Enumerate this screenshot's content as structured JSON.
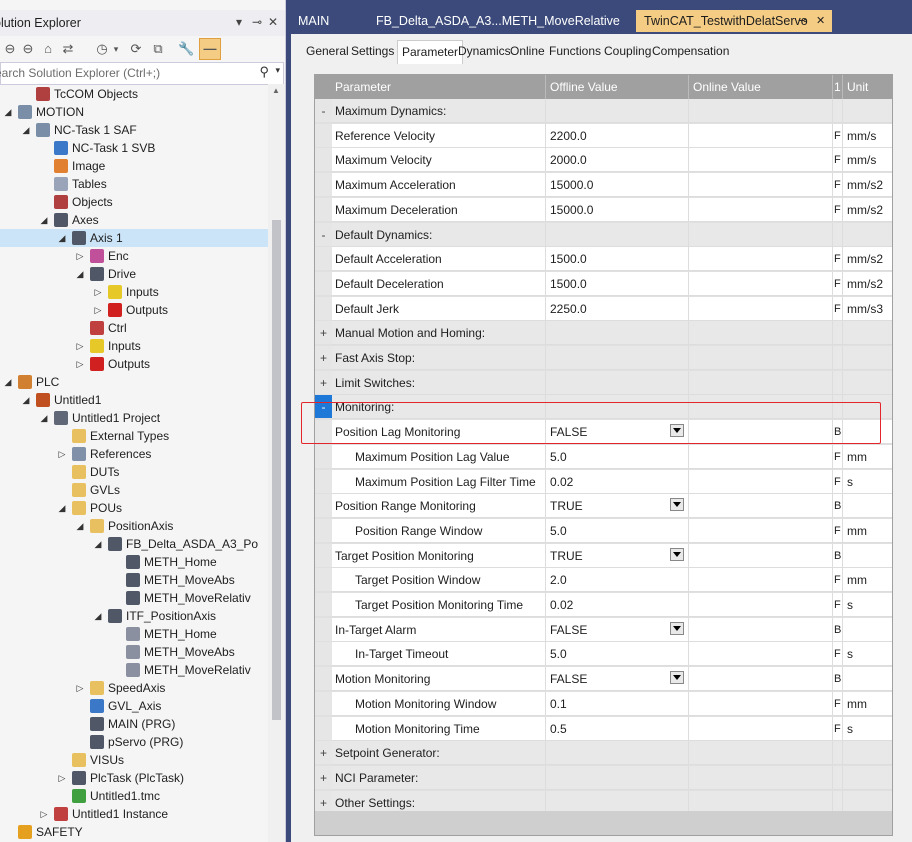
{
  "solution_explorer": {
    "title": "olution Explorer",
    "search_placeholder": "earch Solution Explorer (Ctrl+;)",
    "tree": [
      {
        "label": "TcCOM Objects",
        "indent": 2,
        "expand": "",
        "icon": "tccom-icon",
        "color": "#b04040"
      },
      {
        "label": "MOTION",
        "indent": 1,
        "expand": "◢",
        "icon": "motion-icon",
        "color": "#7a8ea8"
      },
      {
        "label": "NC-Task 1 SAF",
        "indent": 2,
        "expand": "◢",
        "icon": "nc-task-icon",
        "color": "#7a8ea8"
      },
      {
        "label": "NC-Task 1 SVB",
        "indent": 3,
        "expand": "",
        "icon": "nc-svb-icon",
        "color": "#3c78c8"
      },
      {
        "label": "Image",
        "indent": 3,
        "expand": "",
        "icon": "image-icon",
        "color": "#e08030"
      },
      {
        "label": "Tables",
        "indent": 3,
        "expand": "",
        "icon": "tables-icon",
        "color": "#9aa4b8"
      },
      {
        "label": "Objects",
        "indent": 3,
        "expand": "",
        "icon": "objects-icon",
        "color": "#b04040"
      },
      {
        "label": "Axes",
        "indent": 3,
        "expand": "◢",
        "icon": "axes-icon",
        "color": "#505868"
      },
      {
        "label": "Axis 1",
        "indent": 4,
        "expand": "◢",
        "icon": "axis-icon",
        "color": "#505868",
        "selected": true
      },
      {
        "label": "Enc",
        "indent": 5,
        "expand": "▷",
        "icon": "encoder-icon",
        "color": "#c0509a"
      },
      {
        "label": "Drive",
        "indent": 5,
        "expand": "◢",
        "icon": "drive-icon",
        "color": "#505868"
      },
      {
        "label": "Inputs",
        "indent": 6,
        "expand": "▷",
        "icon": "inputs-icon",
        "color": "#e6c828"
      },
      {
        "label": "Outputs",
        "indent": 6,
        "expand": "▷",
        "icon": "outputs-icon",
        "color": "#d02020"
      },
      {
        "label": "Ctrl",
        "indent": 5,
        "expand": "",
        "icon": "ctrl-icon",
        "color": "#c04040"
      },
      {
        "label": "Inputs",
        "indent": 5,
        "expand": "▷",
        "icon": "inputs-icon",
        "color": "#e6c828"
      },
      {
        "label": "Outputs",
        "indent": 5,
        "expand": "▷",
        "icon": "outputs-icon",
        "color": "#d02020"
      },
      {
        "label": "PLC",
        "indent": 1,
        "expand": "◢",
        "icon": "plc-icon",
        "color": "#d08030"
      },
      {
        "label": "Untitled1",
        "indent": 2,
        "expand": "◢",
        "icon": "plc-project-icon",
        "color": "#c05020"
      },
      {
        "label": "Untitled1 Project",
        "indent": 3,
        "expand": "◢",
        "icon": "project-icon",
        "color": "#606878"
      },
      {
        "label": "External Types",
        "indent": 4,
        "expand": "",
        "icon": "folder-icon",
        "color": "#e8c060"
      },
      {
        "label": "References",
        "indent": 4,
        "expand": "▷",
        "icon": "references-icon",
        "color": "#8090a8"
      },
      {
        "label": "DUTs",
        "indent": 4,
        "expand": "",
        "icon": "folder-icon",
        "color": "#e8c060"
      },
      {
        "label": "GVLs",
        "indent": 4,
        "expand": "",
        "icon": "folder-icon",
        "color": "#e8c060"
      },
      {
        "label": "POUs",
        "indent": 4,
        "expand": "◢",
        "icon": "folder-open-icon",
        "color": "#e8c060"
      },
      {
        "label": "PositionAxis",
        "indent": 5,
        "expand": "◢",
        "icon": "folder-open-icon",
        "color": "#e8c060"
      },
      {
        "label": "FB_Delta_ASDA_A3_Po",
        "indent": 6,
        "expand": "◢",
        "icon": "function-block-icon",
        "color": "#505868"
      },
      {
        "label": "METH_Home",
        "indent": 7,
        "expand": "",
        "icon": "method-icon",
        "color": "#505868"
      },
      {
        "label": "METH_MoveAbs",
        "indent": 7,
        "expand": "",
        "icon": "method-icon",
        "color": "#505868"
      },
      {
        "label": "METH_MoveRelativ",
        "indent": 7,
        "expand": "",
        "icon": "method-icon",
        "color": "#505868"
      },
      {
        "label": "ITF_PositionAxis",
        "indent": 6,
        "expand": "◢",
        "icon": "interface-icon",
        "color": "#505868"
      },
      {
        "label": "METH_Home",
        "indent": 7,
        "expand": "",
        "icon": "method-icon",
        "color": "#8a90a0"
      },
      {
        "label": "METH_MoveAbs",
        "indent": 7,
        "expand": "",
        "icon": "method-icon",
        "color": "#8a90a0"
      },
      {
        "label": "METH_MoveRelativ",
        "indent": 7,
        "expand": "",
        "icon": "method-icon",
        "color": "#8a90a0"
      },
      {
        "label": "SpeedAxis",
        "indent": 5,
        "expand": "▷",
        "icon": "folder-icon",
        "color": "#e8c060"
      },
      {
        "label": "GVL_Axis",
        "indent": 5,
        "expand": "",
        "icon": "gvl-icon",
        "color": "#3c78c8"
      },
      {
        "label": "MAIN (PRG)",
        "indent": 5,
        "expand": "",
        "icon": "program-icon",
        "color": "#505868"
      },
      {
        "label": "pServo (PRG)",
        "indent": 5,
        "expand": "",
        "icon": "program-icon",
        "color": "#505868"
      },
      {
        "label": "VISUs",
        "indent": 4,
        "expand": "",
        "icon": "folder-icon",
        "color": "#e8c060"
      },
      {
        "label": "PlcTask (PlcTask)",
        "indent": 4,
        "expand": "▷",
        "icon": "task-icon",
        "color": "#505868"
      },
      {
        "label": "Untitled1.tmc",
        "indent": 4,
        "expand": "",
        "icon": "tmc-icon",
        "color": "#40a040"
      },
      {
        "label": "Untitled1 Instance",
        "indent": 3,
        "expand": "▷",
        "icon": "instance-icon",
        "color": "#c04040"
      },
      {
        "label": "SAFETY",
        "indent": 1,
        "expand": "",
        "icon": "safety-icon",
        "color": "#e6a020"
      }
    ]
  },
  "doc_tabs": [
    {
      "label": "MAIN"
    },
    {
      "label": "FB_Delta_ASDA_A3...METH_MoveRelative"
    },
    {
      "label": "TwinCAT_TestwithDelatServo",
      "active": true,
      "pin": "⊸",
      "close": "✕"
    }
  ],
  "sub_tabs": [
    {
      "label": "General"
    },
    {
      "label": "Settings"
    },
    {
      "label": "Parameter",
      "active": true
    },
    {
      "label": "Dynamics"
    },
    {
      "label": "Online"
    },
    {
      "label": "Functions"
    },
    {
      "label": "Coupling"
    },
    {
      "label": "Compensation"
    }
  ],
  "grid": {
    "headers": {
      "parameter": "Parameter",
      "offline": "Offline Value",
      "online": "Online Value",
      "t": "1",
      "unit": "Unit"
    },
    "rows": [
      {
        "type": "group",
        "exp": "-",
        "name": "Maximum Dynamics:"
      },
      {
        "name": "Reference Velocity",
        "offline": "2200.0",
        "t": "F",
        "unit": "mm/s"
      },
      {
        "name": "Maximum Velocity",
        "offline": "2000.0",
        "t": "F",
        "unit": "mm/s"
      },
      {
        "name": "Maximum Acceleration",
        "offline": "15000.0",
        "t": "F",
        "unit": "mm/s2"
      },
      {
        "name": "Maximum Deceleration",
        "offline": "15000.0",
        "t": "F",
        "unit": "mm/s2"
      },
      {
        "type": "group",
        "exp": "-",
        "name": "Default Dynamics:"
      },
      {
        "name": "Default Acceleration",
        "offline": "1500.0",
        "t": "F",
        "unit": "mm/s2"
      },
      {
        "name": "Default Deceleration",
        "offline": "1500.0",
        "t": "F",
        "unit": "mm/s2"
      },
      {
        "name": "Default Jerk",
        "offline": "2250.0",
        "t": "F",
        "unit": "mm/s3"
      },
      {
        "type": "group",
        "exp": "+",
        "name": "Manual Motion and Homing:"
      },
      {
        "type": "group",
        "exp": "+",
        "name": "Fast Axis Stop:"
      },
      {
        "type": "group",
        "exp": "+",
        "name": "Limit Switches:"
      },
      {
        "type": "group",
        "exp": "-",
        "name": "Monitoring:",
        "selected": true
      },
      {
        "name": "Position Lag Monitoring",
        "offline": "FALSE",
        "t": "B",
        "unit": "",
        "dropdown": true
      },
      {
        "name": "Maximum Position Lag Value",
        "offline": "5.0",
        "t": "F",
        "unit": "mm",
        "sub": true
      },
      {
        "name": "Maximum Position Lag Filter Time",
        "offline": "0.02",
        "t": "F",
        "unit": "s",
        "sub": true
      },
      {
        "name": "Position Range Monitoring",
        "offline": "TRUE",
        "t": "B",
        "unit": "",
        "dropdown": true
      },
      {
        "name": "Position Range Window",
        "offline": "5.0",
        "t": "F",
        "unit": "mm",
        "sub": true
      },
      {
        "name": "Target Position Monitoring",
        "offline": "TRUE",
        "t": "B",
        "unit": "",
        "dropdown": true
      },
      {
        "name": "Target Position Window",
        "offline": "2.0",
        "t": "F",
        "unit": "mm",
        "sub": true
      },
      {
        "name": "Target Position Monitoring Time",
        "offline": "0.02",
        "t": "F",
        "unit": "s",
        "sub": true
      },
      {
        "name": "In-Target Alarm",
        "offline": "FALSE",
        "t": "B",
        "unit": "",
        "dropdown": true
      },
      {
        "name": "In-Target Timeout",
        "offline": "5.0",
        "t": "F",
        "unit": "s",
        "sub": true
      },
      {
        "name": "Motion Monitoring",
        "offline": "FALSE",
        "t": "B",
        "unit": "",
        "dropdown": true
      },
      {
        "name": "Motion Monitoring Window",
        "offline": "0.1",
        "t": "F",
        "unit": "mm",
        "sub": true
      },
      {
        "name": "Motion Monitoring Time",
        "offline": "0.5",
        "t": "F",
        "unit": "s",
        "sub": true
      },
      {
        "type": "group",
        "exp": "+",
        "name": "Setpoint Generator:"
      },
      {
        "type": "group",
        "exp": "+",
        "name": "NCI Parameter:"
      },
      {
        "type": "group",
        "exp": "+",
        "name": "Other Settings:"
      }
    ]
  },
  "colors": {
    "accent": "#f5cc84",
    "selection": "#cce4f7",
    "highlight_box": "#e3262b"
  }
}
